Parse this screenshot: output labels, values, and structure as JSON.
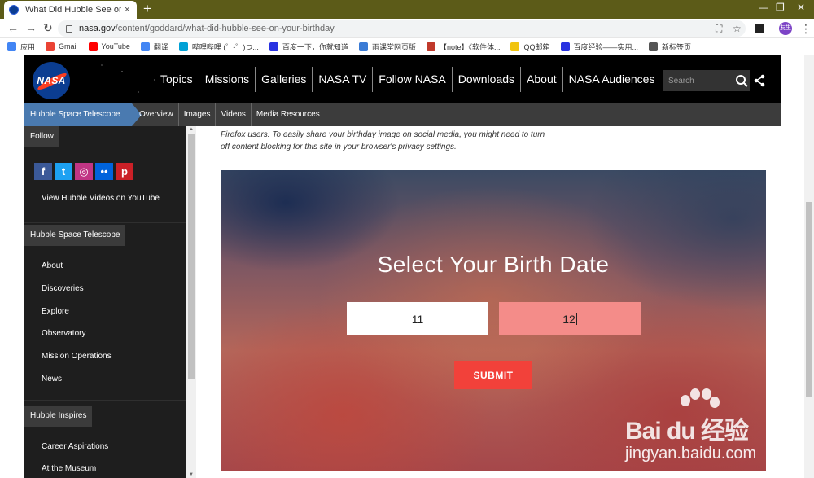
{
  "browser": {
    "tab_title": "What Did Hubble See on You",
    "tab_close": "×",
    "new_tab": "+",
    "url_host": "nasa.gov",
    "url_path": "/content/goddard/what-did-hubble-see-on-your-birthday",
    "profile_label": "友生",
    "bookmarks": [
      {
        "label": "应用",
        "color": "#4285f4"
      },
      {
        "label": "Gmail",
        "color": "#ea4335"
      },
      {
        "label": "YouTube",
        "color": "#ff0000"
      },
      {
        "label": "翻译",
        "color": "#4285f4"
      },
      {
        "label": "哔哩哔哩 (゜-゜)つ...",
        "color": "#00a1d6"
      },
      {
        "label": "百度一下，你就知道",
        "color": "#2932e1"
      },
      {
        "label": "雨课堂网页版",
        "color": "#3a7bd5"
      },
      {
        "label": "【note】《软件体...",
        "color": "#c0392b"
      },
      {
        "label": "QQ邮箱",
        "color": "#f1c40f"
      },
      {
        "label": "百度经验——实用...",
        "color": "#2932e1"
      },
      {
        "label": "新标签页",
        "color": "#555555"
      }
    ]
  },
  "header": {
    "logo_text": "NASA",
    "nav": [
      "Topics",
      "Missions",
      "Galleries",
      "NASA TV",
      "Follow NASA",
      "Downloads",
      "About",
      "NASA Audiences"
    ],
    "search_placeholder": "Search"
  },
  "subnav": {
    "active": "Hubble Space Telescope",
    "items": [
      "Overview",
      "Images",
      "Videos",
      "Media Resources"
    ]
  },
  "sidebar": {
    "follow_heading": "Follow",
    "social": [
      {
        "name": "facebook",
        "glyph": "f",
        "color": "#3b5998"
      },
      {
        "name": "twitter",
        "glyph": "t",
        "color": "#1da1f2"
      },
      {
        "name": "instagram",
        "glyph": "◎",
        "color": "#c13584"
      },
      {
        "name": "flickr",
        "glyph": "••",
        "color": "#0063dc"
      },
      {
        "name": "pinterest",
        "glyph": "p",
        "color": "#cb2027"
      }
    ],
    "youtube_link": "View Hubble Videos on YouTube",
    "hubble_heading": "Hubble Space Telescope",
    "hubble_links": [
      "About",
      "Discoveries",
      "Explore",
      "Observatory",
      "Mission Operations",
      "News"
    ],
    "inspires_heading": "Hubble Inspires",
    "inspires_links": [
      "Career Aspirations",
      "At the Museum"
    ]
  },
  "main": {
    "note_line1": "Firefox users: To easily share your birthday image on social media, you might need to turn",
    "note_line2": "off content blocking for this site in your browser's privacy settings.",
    "form_title": "Select Your Birth Date",
    "month_value": "11",
    "day_value": "12",
    "submit_label": "SUBMIT"
  },
  "watermark": {
    "brand": "Bai du 经验",
    "url": "jingyan.baidu.com"
  }
}
